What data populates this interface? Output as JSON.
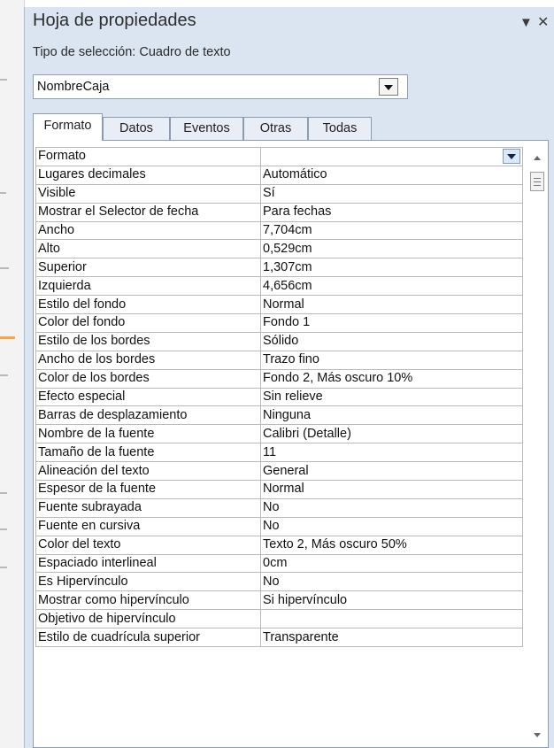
{
  "panel": {
    "title": "Hoja de propiedades",
    "selection_type": "Tipo de selección: Cuadro de texto",
    "object_combo": {
      "value": "NombreCaja"
    },
    "tabs": [
      {
        "label": "Formato",
        "active": true
      },
      {
        "label": "Datos",
        "active": false
      },
      {
        "label": "Eventos",
        "active": false
      },
      {
        "label": "Otras",
        "active": false
      },
      {
        "label": "Todas",
        "active": false
      }
    ],
    "properties": [
      {
        "name": "Formato",
        "value": ""
      },
      {
        "name": "Lugares decimales",
        "value": "Automático"
      },
      {
        "name": "Visible",
        "value": "Sí"
      },
      {
        "name": "Mostrar el Selector de fecha",
        "value": "Para fechas"
      },
      {
        "name": "Ancho",
        "value": "7,704cm"
      },
      {
        "name": "Alto",
        "value": "0,529cm"
      },
      {
        "name": "Superior",
        "value": "1,307cm"
      },
      {
        "name": "Izquierda",
        "value": "4,656cm"
      },
      {
        "name": "Estilo del fondo",
        "value": "Normal"
      },
      {
        "name": "Color del fondo",
        "value": "Fondo 1"
      },
      {
        "name": "Estilo de los bordes",
        "value": "Sólido"
      },
      {
        "name": "Ancho de los bordes",
        "value": "Trazo fino"
      },
      {
        "name": "Color de los bordes",
        "value": "Fondo 2, Más oscuro 10%"
      },
      {
        "name": "Efecto especial",
        "value": "Sin relieve"
      },
      {
        "name": "Barras de desplazamiento",
        "value": "Ninguna"
      },
      {
        "name": "Nombre de la fuente",
        "value": "Calibri (Detalle)"
      },
      {
        "name": "Tamaño de la fuente",
        "value": "11"
      },
      {
        "name": "Alineación del texto",
        "value": "General"
      },
      {
        "name": "Espesor de la fuente",
        "value": "Normal"
      },
      {
        "name": "Fuente subrayada",
        "value": "No"
      },
      {
        "name": "Fuente en cursiva",
        "value": "No"
      },
      {
        "name": "Color del texto",
        "value": "Texto 2, Más oscuro 50%"
      },
      {
        "name": "Espaciado interlineal",
        "value": "0cm"
      },
      {
        "name": "Es Hipervínculo",
        "value": "No"
      },
      {
        "name": "Mostrar como hipervínculo",
        "value": "Si hipervínculo"
      },
      {
        "name": "Objetivo de hipervínculo",
        "value": ""
      },
      {
        "name": "Estilo de cuadrícula superior",
        "value": "Transparente"
      }
    ],
    "icons": {
      "dropdown": "dropdown-arrow-icon",
      "close": "close-icon",
      "scroll_up": "scroll-up-icon",
      "scroll_down": "scroll-down-icon"
    },
    "colors": {
      "panel_bg": "#dbe5f1",
      "accent": "#f3a64a"
    }
  }
}
